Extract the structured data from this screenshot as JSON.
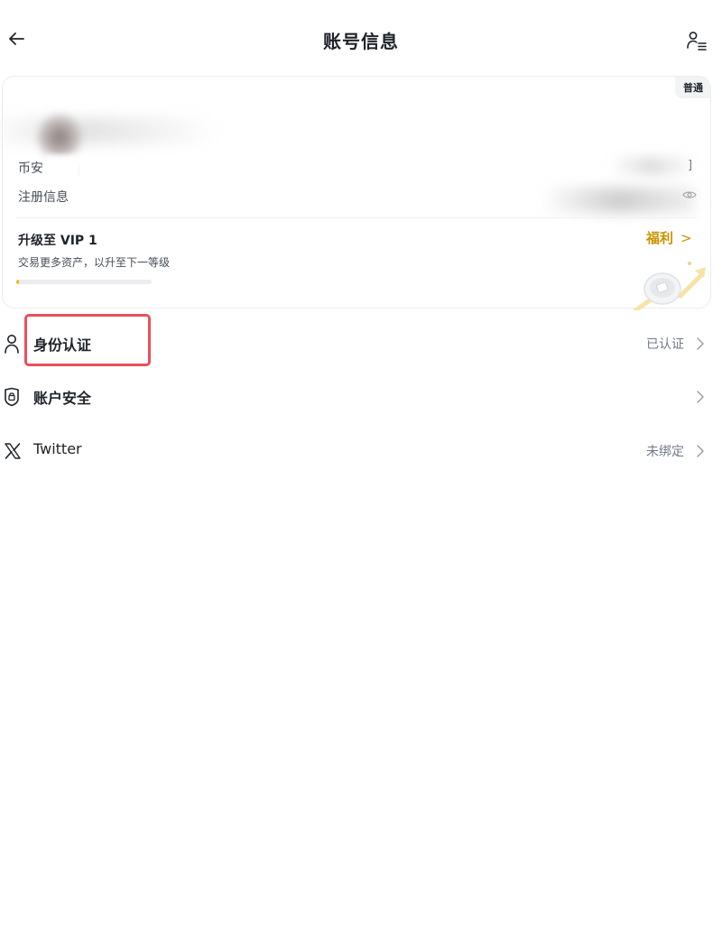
{
  "header": {
    "title": "账号信息"
  },
  "account_card": {
    "level_badge": "普通",
    "uid_label": "币安",
    "uid_label_suffix": "j",
    "uid_value_suffix": "]",
    "registration_label": "注册信息",
    "vip": {
      "title": "升级至 VIP 1",
      "subtitle": "交易更多资产，以升至下一等级",
      "progress_percent": 2,
      "benefit_label": "福利",
      "benefit_chevron": ">"
    }
  },
  "rows": [
    {
      "label": "身份认证",
      "value": "已认证",
      "icon": "person-icon",
      "highlighted": true
    },
    {
      "label": "账户安全",
      "value": "",
      "icon": "shield-lock-icon",
      "highlighted": false
    },
    {
      "label": "Twitter",
      "value": "未绑定",
      "icon": "x-logo-icon",
      "highlighted": false
    }
  ],
  "colors": {
    "accent": "#c99400",
    "progress": "#f0b90b",
    "highlight": "#e8505b",
    "text_primary": "#1e2329",
    "text_secondary": "#707a8a"
  }
}
